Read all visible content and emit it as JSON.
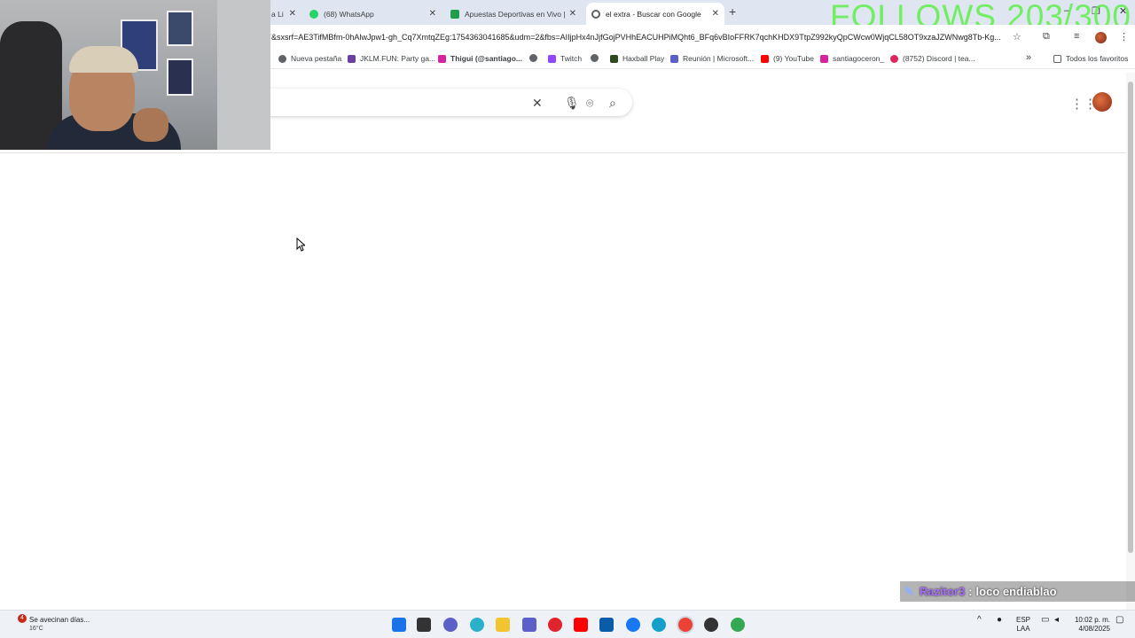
{
  "tabs": [
    {
      "title": "a Li",
      "active": false
    },
    {
      "title": "(68) WhatsApp",
      "active": false
    },
    {
      "title": "Apuestas Deportivas en Vivo | A",
      "active": false
    },
    {
      "title": "el extra - Buscar con Google",
      "active": true
    }
  ],
  "overlay_follows": "FOLLOWS 203/300",
  "address_bar": {
    "url": "&sxsrf=AE3TifMBfm-0hAlwJpw1-gh_Cq7XmtqZEg:1754363041685&udm=2&fbs=AIIjpHx4nJjfGojPVHhEACUHPiMQht6_BFq6vBIoFFRK7qchKHDX9TtpZ992kyQpCWcw0WjqCL58OT9xzaJZWNwg8Tb-Kg..."
  },
  "bookmarks": [
    {
      "label": "Nueva pestaña",
      "color": "#5f6368"
    },
    {
      "label": "JKLM.FUN: Party ga...",
      "color": "#6b3fa0"
    },
    {
      "label": "Thigui (@santiago...",
      "color": "#d6249f"
    },
    {
      "label": "",
      "color": "#5f6368"
    },
    {
      "label": "Twitch",
      "color": "#9146ff"
    },
    {
      "label": "",
      "color": "#5f6368"
    },
    {
      "label": "Haxball Play",
      "color": "#2d4a1e"
    },
    {
      "label": "Reunión | Microsoft...",
      "color": "#5b5fc7"
    },
    {
      "label": "(9) YouTube",
      "color": "#ff0000"
    },
    {
      "label": "santiagoceron_",
      "color": "#d6249f"
    },
    {
      "label": "(8752) Discord | tea...",
      "color": "#e0245e"
    }
  ],
  "all_favorites_label": "Todos los favoritos",
  "chat": {
    "user": "Razitor3",
    "separator": ":",
    "message": "loco endiablao"
  },
  "taskbar": {
    "weather_text": "Se avecinan días...",
    "weather_temp": "16°C",
    "weather_badge": "4",
    "lang_top": "ESP",
    "lang_bottom": "LAA",
    "time": "10:02 p. m.",
    "date": "4/08/2025"
  },
  "colors": {
    "accent": "#1a73e8",
    "follows_overlay": "#5ef04a",
    "chat_user": "#a86cff"
  }
}
